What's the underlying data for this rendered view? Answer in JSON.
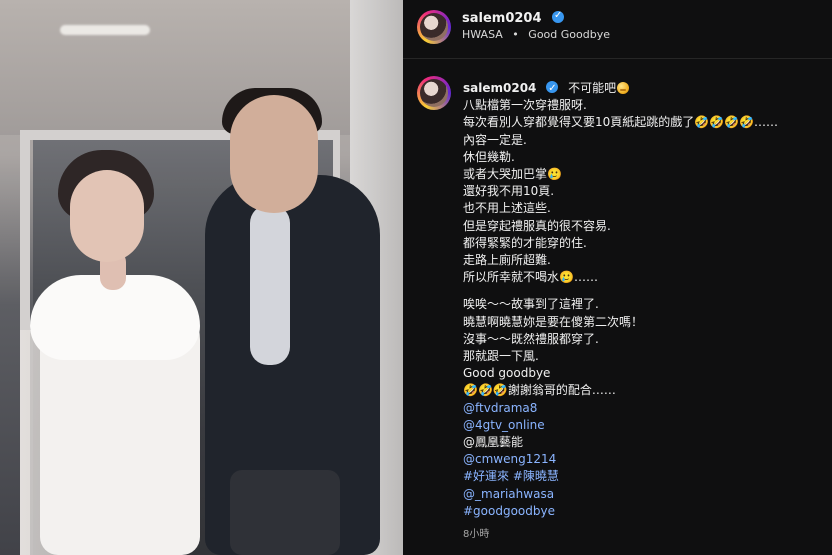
{
  "header": {
    "username": "salem0204",
    "audio_artist": "HWASA",
    "audio_dot": "•",
    "audio_title": "Good Goodbye"
  },
  "post": {
    "username": "salem0204",
    "first_line_text": "不可能吧",
    "lines": [
      "八點檔第一次穿禮服呀.",
      "每次看別人穿都覺得又要10頁紙起跳的戲了🤣🤣🤣🤣……",
      "內容一定是.",
      "休但幾勒.",
      "或者大哭加巴掌🥲",
      "還好我不用10頁.",
      "也不用上述這些.",
      "但是穿起禮服真的很不容易.",
      "都得緊緊的才能穿的住.",
      "走路上廁所超難.",
      "所以所幸就不喝水🥲……",
      "",
      "唉唉～～故事到了這裡了.",
      "曉慧啊曉慧妳是要在傻第二次嗎！",
      "沒事～～既然禮服都穿了.",
      "那就跟一下風.",
      "Good goodbye",
      "🤣🤣🤣謝謝翁哥的配合……"
    ],
    "links": {
      "ftvdrama8": "@ftvdrama8",
      "4gtv_online": "@4gtv_online",
      "fengfeng": "@鳳凰藝能",
      "cmweng1214": "@cmweng1214",
      "hashtags_1": "#好運來 #陳曉慧",
      "mariahwasa": "@_mariahwasa",
      "goodgoodbye": "#goodgoodbye"
    },
    "time_ago": "8小時"
  },
  "colors": {
    "panel_bg": "#0f0f10",
    "link": "#8ab4ff",
    "verified": "#3897f0"
  }
}
